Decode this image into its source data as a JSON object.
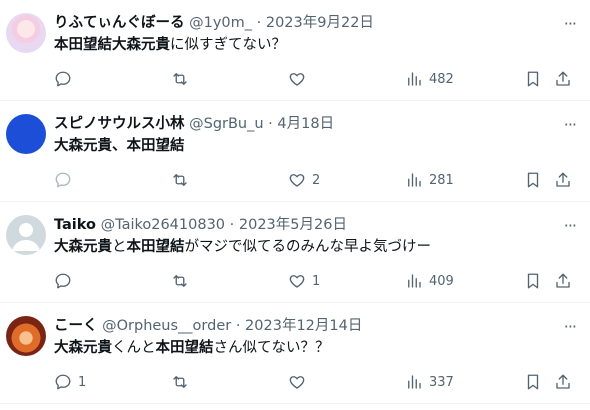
{
  "tweets": [
    {
      "name": "りふてぃんぐぼーる",
      "handle": "@1y0m_",
      "date": "2023年9月22日",
      "text_parts": [
        "本田望結大森元貴",
        "に似すぎてない？",
        "",
        ""
      ],
      "replies": "",
      "likes": "",
      "views": "482",
      "avatar": "anime-avatar"
    },
    {
      "name": "スピノサウルス小林",
      "handle": "@SgrBu_u",
      "date": "4月18日",
      "text_parts": [
        "大森元貴、本田望結",
        "",
        "",
        ""
      ],
      "replies": "",
      "likes": "2",
      "views": "281",
      "avatar": "blue-avatar"
    },
    {
      "name": "Taiko",
      "handle": "@Taiko26410830",
      "date": "2023年5月26日",
      "text_parts": [
        "大森元貴",
        "と",
        "本田望結",
        "がマジで似てるのみんな早よ気づけー"
      ],
      "replies": "",
      "likes": "1",
      "views": "409",
      "avatar": "default-avatar"
    },
    {
      "name": "こーく",
      "handle": "@Orpheus__order",
      "date": "2023年12月14日",
      "text_parts": [
        "大森元貴",
        "くんと",
        "本田望結",
        "さん似てない？？"
      ],
      "replies": "1",
      "likes": "",
      "views": "337",
      "avatar": "fire-avatar"
    }
  ],
  "separator": " · ",
  "more_label": "···"
}
